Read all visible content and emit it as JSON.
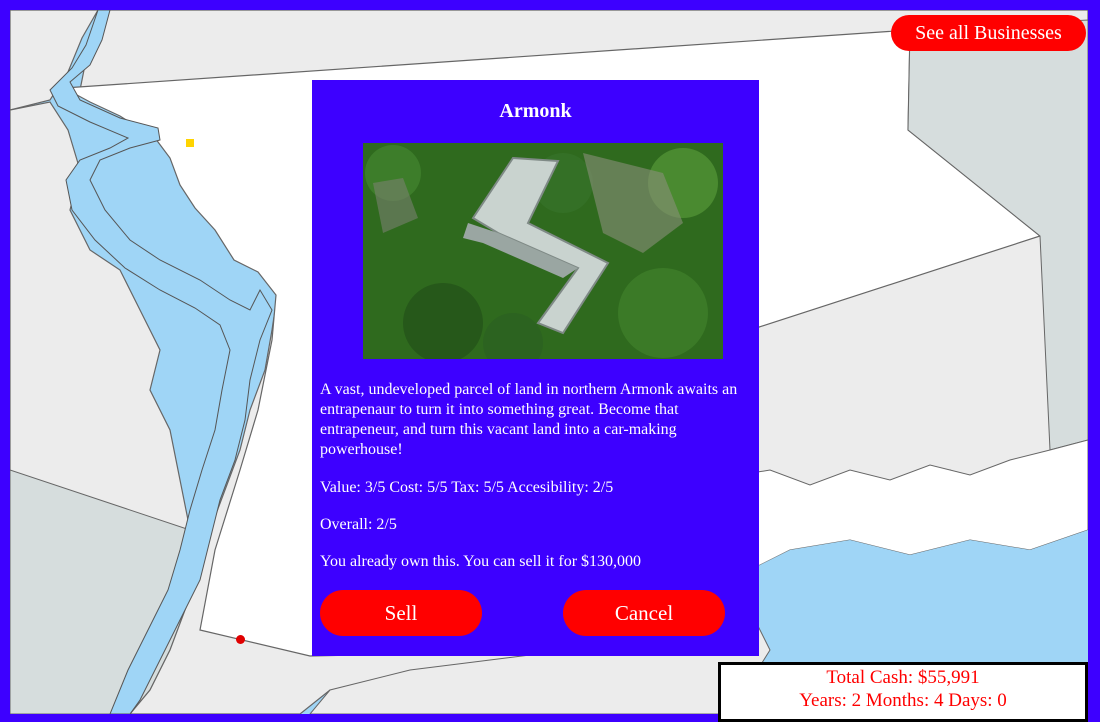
{
  "header": {
    "see_all_label": "See all Businesses"
  },
  "modal": {
    "title": "Armonk",
    "description": "A vast, undeveloped parcel of land in northern Armonk awaits an entrapenaur to turn it into something great. Become that entrapeneur, and turn this vacant land into a car-making powerhouse!",
    "stats": "Value: 3/5 Cost: 5/5 Tax: 5/5 Accesibility: 2/5",
    "overall": "Overall: 2/5",
    "ownership": "You already own this. You can sell it for $130,000",
    "sell_label": "Sell",
    "cancel_label": "Cancel"
  },
  "status": {
    "cash": "Total Cash: $55,991",
    "time": "Years: 2 Months: 4 Days: 0"
  },
  "map": {
    "markers": [
      {
        "name": "yellow-dot",
        "color": "#ffd400"
      },
      {
        "name": "yellow-square",
        "color": "#ffd400"
      },
      {
        "name": "red-dot",
        "color": "#e00000"
      }
    ]
  },
  "colors": {
    "frame": "#3d00ff",
    "button": "#ff0000",
    "water": "#9fd5f6",
    "land": "#ececec"
  }
}
